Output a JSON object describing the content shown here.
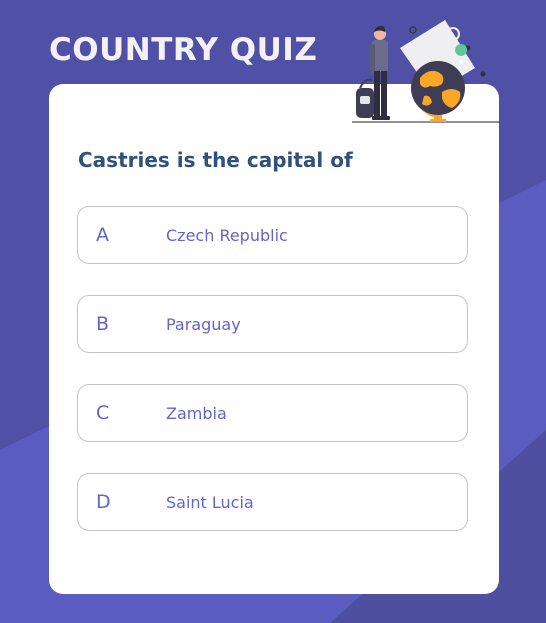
{
  "app": {
    "title": "COUNTRY QUIZ"
  },
  "quiz": {
    "question": "Castries is the capital of",
    "options": [
      {
        "letter": "A",
        "text": "Czech Republic"
      },
      {
        "letter": "B",
        "text": "Paraguay"
      },
      {
        "letter": "C",
        "text": "Zambia"
      },
      {
        "letter": "D",
        "text": "Saint Lucia"
      }
    ]
  },
  "colors": {
    "background": "#5a5cbf",
    "background_dark": "#4e4f9e",
    "title": "#f2f2f2",
    "question": "#2f527b",
    "option_text": "#6066d0",
    "option_border": "#c4c4cc",
    "globe_accent": "#f9a826"
  },
  "icons": {
    "illustration": "traveler-globe-icon"
  }
}
